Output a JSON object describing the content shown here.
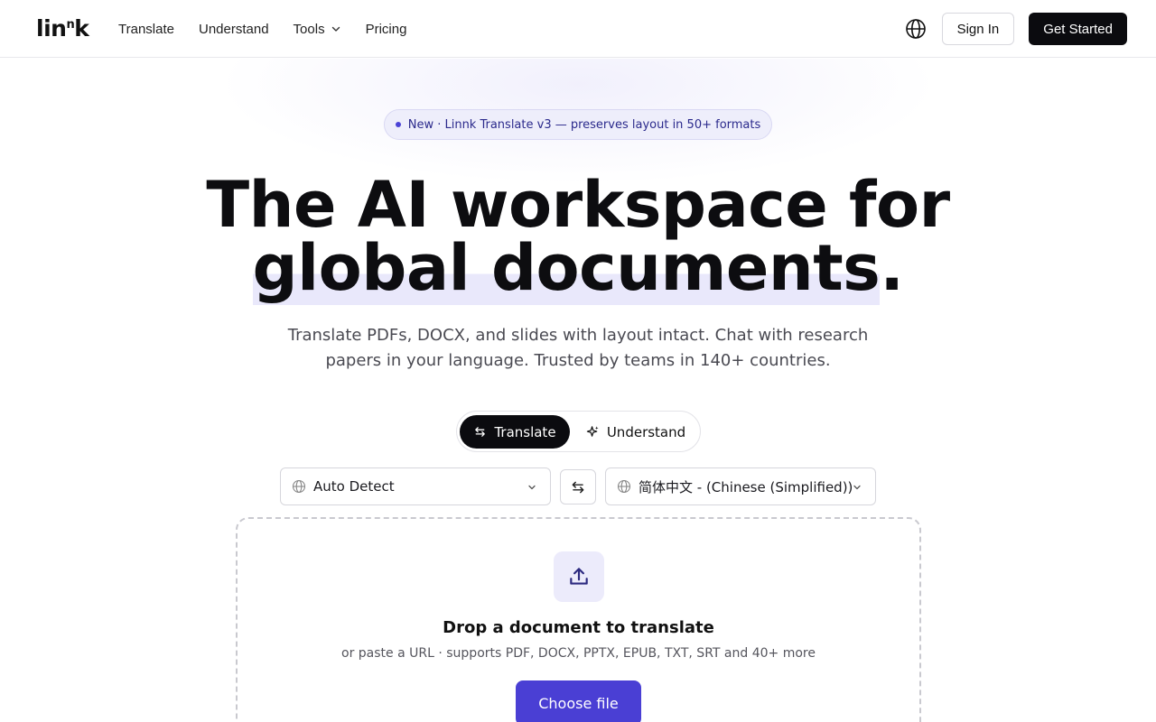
{
  "header": {
    "logo": {
      "part1": "lin",
      "part2": "n",
      "part3": "k"
    },
    "nav": [
      {
        "label": "Translate"
      },
      {
        "label": "Understand"
      },
      {
        "label": "Tools"
      },
      {
        "label": "Pricing"
      }
    ],
    "signin_label": "Sign In",
    "getstarted_label": "Get Started"
  },
  "hero": {
    "badge": "New · Linnk Translate v3 — preserves layout in 50+ formats",
    "headline_line1": "The AI workspace for",
    "headline_highlight": "global documents",
    "headline_end": ".",
    "subtitle": "Translate PDFs, DOCX, and slides with layout intact. Chat with research papers in your language. Trusted by teams in 140+ countries."
  },
  "mode_toggle": {
    "translate_label": "Translate",
    "understand_label": "Understand",
    "active": "Translate"
  },
  "language": {
    "source": "Auto Detect",
    "target": "简体中文 - (Chinese (Simplified))"
  },
  "dropzone": {
    "title": "Drop a document to translate",
    "subtitle": "or paste a URL · supports PDF, DOCX, PPTX, EPUB, TXT, SRT and 40+ more",
    "button_label": "Choose file"
  },
  "icons": {
    "globe": "globe-icon",
    "chevron": "chevron-down-icon",
    "swap": "swap-arrows-icon",
    "sparkle": "sparkle-icon",
    "upload": "upload-icon"
  },
  "colors": {
    "accent": "#4a3fd4",
    "dark": "#0b0b0f",
    "badge_bg": "#eeeefb",
    "highlight": "#e9e8fb"
  }
}
